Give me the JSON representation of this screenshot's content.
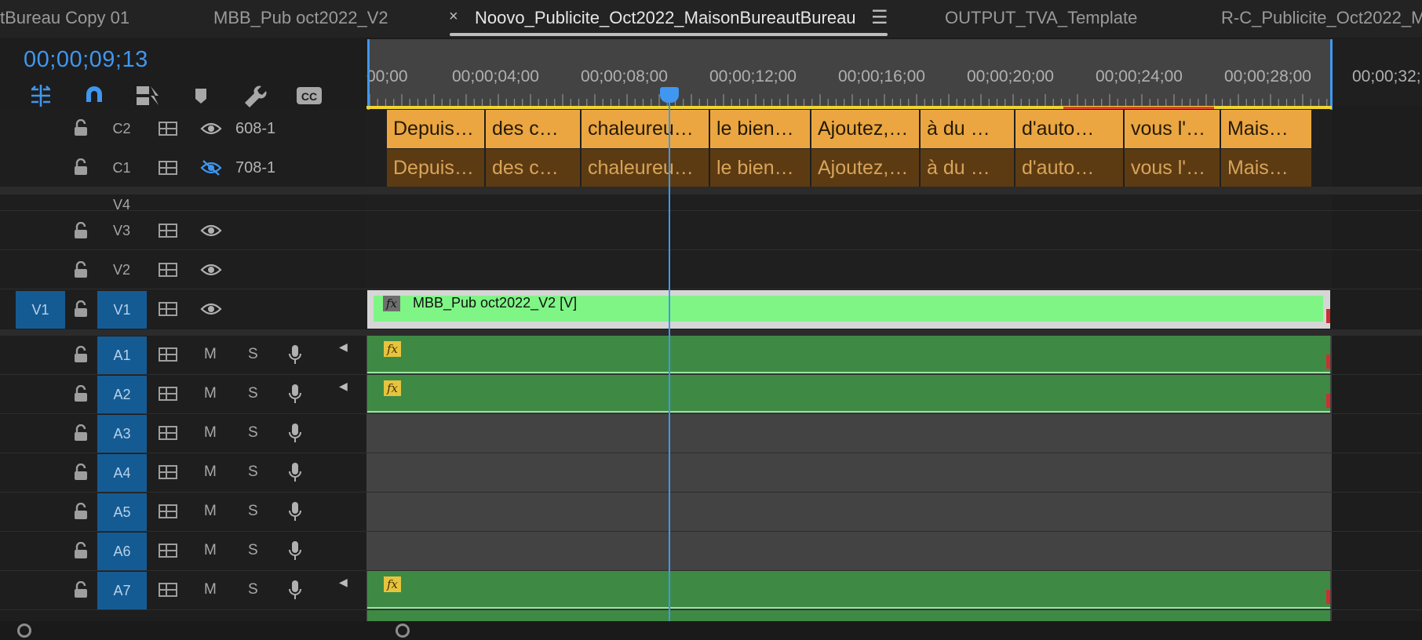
{
  "tabs": [
    {
      "label": "tBureau Copy 01"
    },
    {
      "label": "MBB_Pub oct2022_V2"
    },
    {
      "label": "Noovo_Publicite_Oct2022_MaisonBureautBureau"
    },
    {
      "label": "OUTPUT_TVA_Template"
    },
    {
      "label": "R-C_Publicite_Oct2022_M"
    }
  ],
  "tab_close": "×",
  "tab_menu": "☰",
  "timecode": "00;00;09;13",
  "ruler_labels": [
    "00;00",
    "00;00;04;00",
    "00;00;08;00",
    "00;00;12;00",
    "00;00;16;00",
    "00;00;20;00",
    "00;00;24;00",
    "00;00;28;00",
    "00;00;32;"
  ],
  "caption_tracks": [
    {
      "label": "C2",
      "name": "608-1"
    },
    {
      "label": "C1",
      "name": "708-1"
    }
  ],
  "captions": [
    "Depuis…",
    "des c…",
    "chaleureu…",
    "le bien…",
    "Ajoutez,…",
    "à du …",
    "d'auto…",
    "vous l'…",
    "Mais…"
  ],
  "video_tracks": [
    {
      "label": "V4"
    },
    {
      "label": "V3"
    },
    {
      "label": "V2"
    },
    {
      "label": "V1",
      "target": "V1"
    }
  ],
  "video_clip": {
    "fx": "fx",
    "label": "MBB_Pub oct2022_V2 [V]"
  },
  "audio_tracks": [
    {
      "label": "A1",
      "mute": "M",
      "solo": "S"
    },
    {
      "label": "A2",
      "mute": "M",
      "solo": "S"
    },
    {
      "label": "A3",
      "mute": "M",
      "solo": "S"
    },
    {
      "label": "A4",
      "mute": "M",
      "solo": "S"
    },
    {
      "label": "A5",
      "mute": "M",
      "solo": "S"
    },
    {
      "label": "A6",
      "mute": "M",
      "solo": "S"
    },
    {
      "label": "A7",
      "mute": "M",
      "solo": "S"
    }
  ],
  "audio_fx": "fx",
  "icons": {
    "lock": "lock-open-icon",
    "sync": "sync-lock-icon",
    "eye": "eye-icon",
    "eye_off": "eye-hidden-icon",
    "mic": "microphone-icon"
  },
  "colors": {
    "accent": "#3f97f0",
    "caption_clip": "#eba641",
    "caption_clip_dim": "#5c3b13",
    "video_clip": "#7ff586",
    "audio_clip": "#3e8a44",
    "work_area": "#f0d530"
  }
}
